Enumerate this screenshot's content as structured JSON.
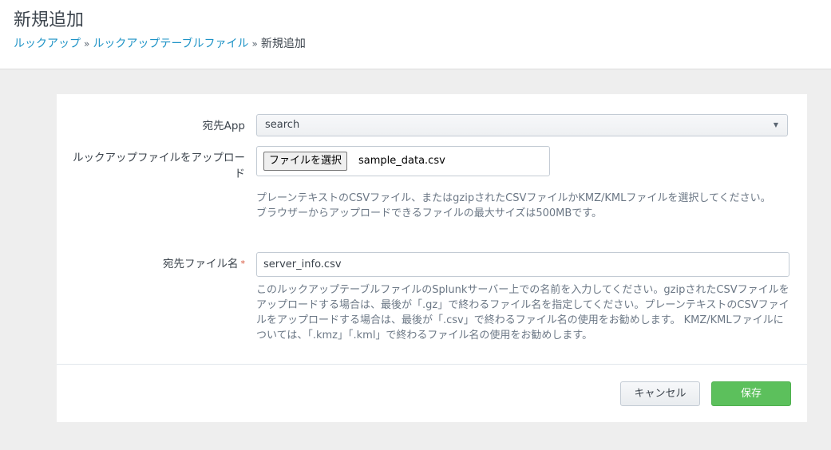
{
  "header": {
    "title": "新規追加",
    "breadcrumb": [
      {
        "label": "ルックアップ"
      },
      {
        "label": "ルックアップテーブルファイル"
      },
      {
        "label": "新規追加"
      }
    ],
    "separator": "»"
  },
  "form": {
    "dest_app": {
      "label": "宛先App",
      "value": "search"
    },
    "upload": {
      "label": "ルックアップファイルをアップロード",
      "button_label": "ファイルを選択",
      "file_name": "sample_data.csv",
      "help_line1": "プレーンテキストのCSVファイル、またはgzipされたCSVファイルかKMZ/KMLファイルを選択してください。",
      "help_line2": "ブラウザーからアップロードできるファイルの最大サイズは500MBです。"
    },
    "dest_filename": {
      "label": "宛先ファイル名",
      "required_mark": "*",
      "value": "server_info.csv",
      "help": "このルックアップテーブルファイルのSplunkサーバー上での名前を入力してください。gzipされたCSVファイルをアップロードする場合は、最後が「.gz」で終わるファイル名を指定してください。プレーンテキストのCSVファイルをアップロードする場合は、最後が「.csv」で終わるファイル名の使用をお勧めします。 KMZ/KMLファイルについては、「.kmz」「.kml」で終わるファイル名の使用をお勧めします。"
    }
  },
  "actions": {
    "cancel_label": "キャンセル",
    "save_label": "保存"
  },
  "colors": {
    "link": "#1e93c6",
    "save_button": "#5cc05c",
    "required": "#d6563c"
  }
}
